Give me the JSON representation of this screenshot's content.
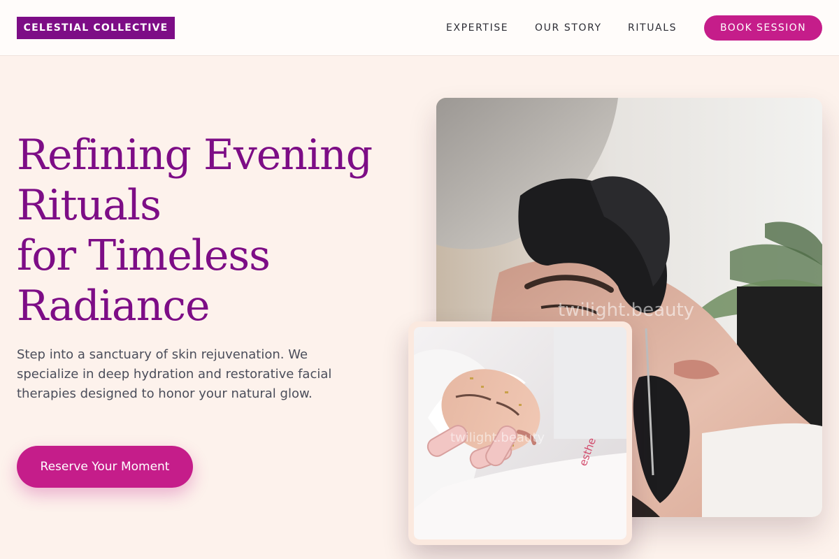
{
  "header": {
    "brand": "CELESTIAL COLLECTIVE",
    "nav": [
      {
        "label": "EXPERTISE"
      },
      {
        "label": "OUR STORY"
      },
      {
        "label": "RITUALS"
      }
    ],
    "book_button": "BOOK SESSION"
  },
  "hero": {
    "headline_lines": [
      "Refining Evening",
      "Rituals",
      "for Timeless",
      "Radiance"
    ],
    "lead": "Step into a sanctuary of skin rejuvenation. We specialize in deep hydration and restorative facial therapies designed to honor your natural glow.",
    "cta": "Reserve Your Moment"
  },
  "images": {
    "main_watermark": "twilight.beauty",
    "inset_watermark": "twilight.beauty",
    "inset_logo_text": "esthe"
  },
  "colors": {
    "brand_purple": "#7d0d86",
    "accent_magenta": "#c51d8a",
    "background": "#fdf2ec",
    "body_text": "#4a4d5a"
  }
}
